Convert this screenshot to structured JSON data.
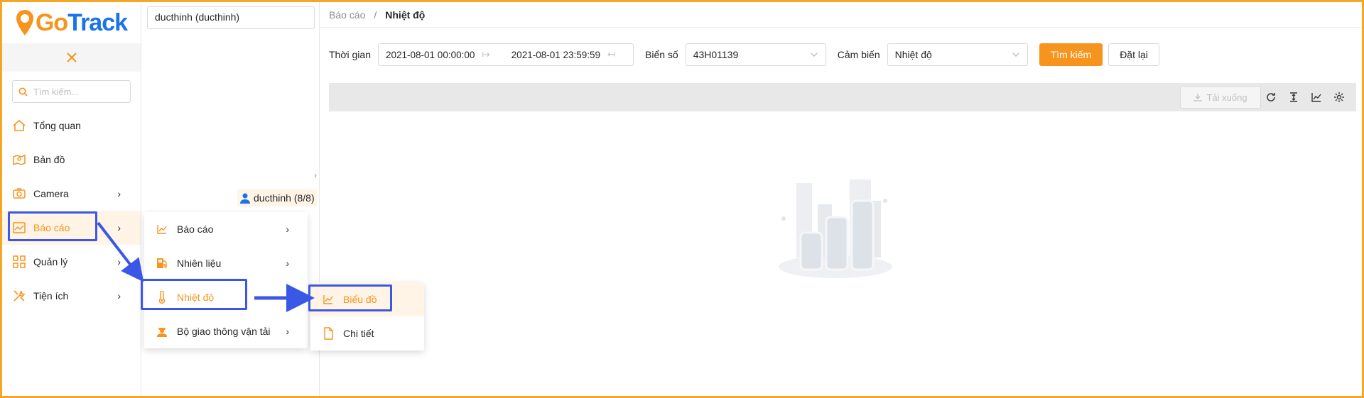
{
  "logo": {
    "part1": "Go",
    "part2": "Track"
  },
  "sidebar": {
    "collapse_icon": "close-icon",
    "search_placeholder": "Tìm kiếm...",
    "items": [
      {
        "label": "Tổng quan",
        "icon": "home-icon"
      },
      {
        "label": "Bản đồ",
        "icon": "map-icon"
      },
      {
        "label": "Camera",
        "icon": "camera-icon"
      },
      {
        "label": "Báo cáo",
        "icon": "chart-icon"
      },
      {
        "label": "Quản lý",
        "icon": "grid-icon"
      },
      {
        "label": "Tiện ích",
        "icon": "tools-icon"
      }
    ]
  },
  "tree": {
    "selected_account": "ducthinh (ducthinh)",
    "user_node": "ducthinh (8/8)"
  },
  "breadcrumb": {
    "parent": "Báo cáo",
    "separator": "/",
    "current": "Nhiệt độ"
  },
  "filters": {
    "time_label": "Thời gian",
    "start_time": "2021-08-01 00:00:00",
    "end_time": "2021-08-01 23:59:59",
    "plate_label": "Biển số",
    "plate_value": "43H01139",
    "sensor_label": "Cảm biến",
    "sensor_value": "Nhiệt độ",
    "search_button": "Tìm kiếm",
    "reset_button": "Đặt lại"
  },
  "toolbar": {
    "download_label": "Tải xuống"
  },
  "submenu_report": [
    {
      "label": "Báo cáo",
      "icon": "line-chart-icon"
    },
    {
      "label": "Nhiên liệu",
      "icon": "fuel-icon"
    },
    {
      "label": "Nhiệt độ",
      "icon": "thermometer-icon"
    },
    {
      "label": "Bộ giao thông vận tải",
      "icon": "officer-icon"
    }
  ],
  "submenu_temperature": [
    {
      "label": "Biểu đồ",
      "icon": "line-chart-icon"
    },
    {
      "label": "Chi tiết",
      "icon": "file-icon"
    }
  ],
  "colors": {
    "accent": "#f7941d",
    "brand_blue": "#1a73e8",
    "highlight": "#3b57e6",
    "frame": "#f5a623"
  }
}
